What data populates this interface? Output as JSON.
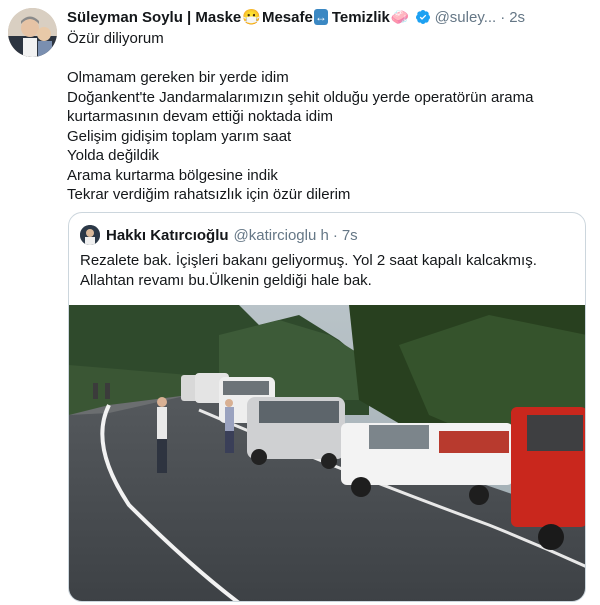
{
  "author": {
    "name": "Süleyman Soylu | Maske",
    "name_part2": "Mesafe",
    "name_part3": "Temizlik",
    "emoji1": "😷",
    "emoji2": "↔",
    "emoji3": "🧼",
    "handle": "@suley...",
    "separator": "·",
    "time": "2s"
  },
  "tweet": {
    "line1": "Özür diliyorum",
    "lines": [
      "Olmamam gereken bir yerde idim",
      "Doğankent'te Jandarmalarımızın şehit olduğu yerde operatörün arama",
      "kurtarmasının devam ettiği noktada idim",
      "Gelişim gidişim toplam yarım saat",
      "Yolda değildik",
      "Arama kurtarma bölgesine indik",
      "Tekrar verdiğim rahatsızlık için özür dilerim"
    ]
  },
  "quoted": {
    "name": "Hakkı Katırcıoğlu",
    "handle": "@katircioglu h",
    "handle_full": "@katircioglu h",
    "separator": "·",
    "time": "7s",
    "lines": [
      "Rezalete bak. İçişleri bakanı geliyormuş. Yol 2 saat kapalı kalcakmış.",
      "Allahtan revamı bu.Ülkenin geldiği hale bak."
    ]
  },
  "colors": {
    "verified": "#1da1f2",
    "secondary_text": "#657786",
    "border": "#ccd6dd"
  }
}
